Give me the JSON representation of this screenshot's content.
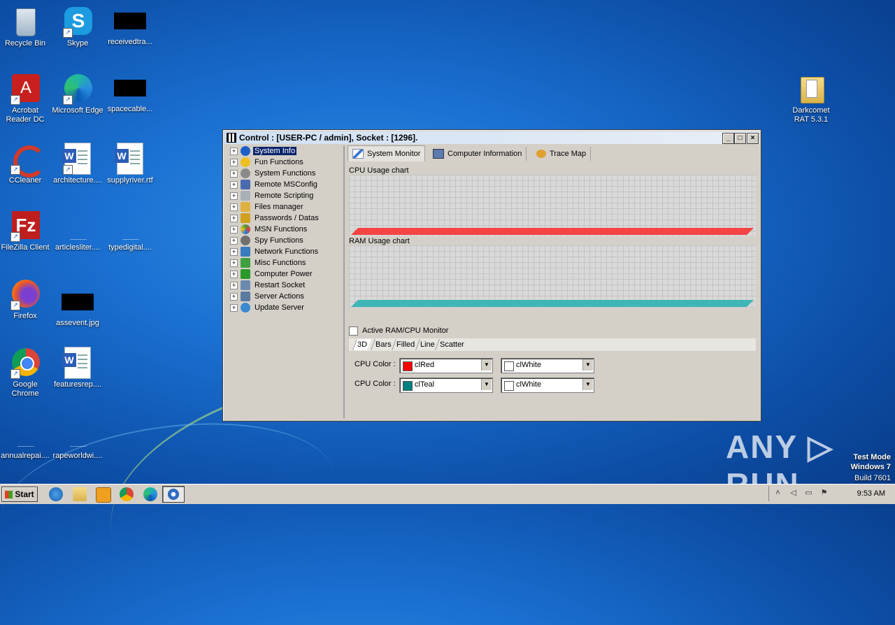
{
  "desktop": {
    "icons": [
      {
        "label": "Recycle Bin"
      },
      {
        "label": "Skype"
      },
      {
        "label": "receivedtra..."
      },
      {
        "label": "Acrobat Reader DC"
      },
      {
        "label": "Microsoft Edge"
      },
      {
        "label": "spacecable..."
      },
      {
        "label": "CCleaner"
      },
      {
        "label": "architecture...."
      },
      {
        "label": "supplyriver.rtf"
      },
      {
        "label": "FileZilla Client"
      },
      {
        "label": "articlesliter...."
      },
      {
        "label": "typedigital...."
      },
      {
        "label": "Firefox"
      },
      {
        "label": "assevent.jpg"
      },
      {
        "label": "Google Chrome"
      },
      {
        "label": "featuresrep...."
      },
      {
        "label": "annualrepai...."
      },
      {
        "label": "rapeworldwi...."
      },
      {
        "label": "Darkcomet RAT 5.3.1"
      }
    ]
  },
  "window": {
    "title": "Control : [USER-PC / admin], Socket : [1296].",
    "min_glyph": "_",
    "max_glyph": "□",
    "close_glyph": "×",
    "tree": [
      {
        "label": "System Info",
        "icon": "info-icon",
        "color": "#1f5fc8"
      },
      {
        "label": "Fun Functions",
        "icon": "smiley-icon",
        "color": "#f0c020"
      },
      {
        "label": "System Functions",
        "icon": "gear-icon",
        "color": "#8a8a8a"
      },
      {
        "label": "Remote MSConfig",
        "icon": "monitor-icon",
        "color": "#4a6ab0"
      },
      {
        "label": "Remote Scripting",
        "icon": "script-icon",
        "color": "#9aa"
      },
      {
        "label": "Files manager",
        "icon": "folder-icon",
        "color": "#e0b040"
      },
      {
        "label": "Passwords / Datas",
        "icon": "key-icon",
        "color": "#d0a020"
      },
      {
        "label": "MSN Functions",
        "icon": "msn-icon",
        "color": "#40a040"
      },
      {
        "label": "Spy Functions",
        "icon": "spy-icon",
        "color": "#707070"
      },
      {
        "label": "Network Functions",
        "icon": "network-icon",
        "color": "#3a7ac0"
      },
      {
        "label": "Misc Functions",
        "icon": "misc-icon",
        "color": "#40a040"
      },
      {
        "label": "Computer Power",
        "icon": "power-icon",
        "color": "#2a9a2a"
      },
      {
        "label": "Restart Socket",
        "icon": "socket-icon",
        "color": "#6a8ab0"
      },
      {
        "label": "Server Actions",
        "icon": "server-icon",
        "color": "#5a7aa0"
      },
      {
        "label": "Update Server",
        "icon": "update-icon",
        "color": "#3a8ad0"
      }
    ],
    "expand_glyph": "+",
    "tabs": [
      {
        "label": "System Monitor"
      },
      {
        "label": "Computer Information"
      },
      {
        "label": "Trace Map"
      }
    ],
    "cpu_chart_label": "CPU Usage chart",
    "ram_chart_label": "RAM Usage chart",
    "cpu_color": "#f44444",
    "ram_color": "#3fb6b6",
    "active_monitor_label": "Active RAM/CPU Monitor",
    "subtabs": [
      "3D",
      "Bars",
      "Filled",
      "Line",
      "Scatter"
    ],
    "options": [
      {
        "label": "CPU Color :",
        "color1_name": "clRed",
        "color1": "#ff0000",
        "color2_name": "clWhite",
        "color2": "#ffffff"
      },
      {
        "label": "CPU Color :",
        "color1_name": "clTeal",
        "color1": "#008080",
        "color2_name": "clWhite",
        "color2": "#ffffff"
      }
    ],
    "dropdown_glyph": "▼"
  },
  "taskbar": {
    "start_label": "Start",
    "clock": "9:53 AM"
  },
  "watermark": {
    "brand": "ANY ▷ RUN",
    "testmode_line1": "Test Mode",
    "testmode_line2": "Windows 7",
    "testmode_line3": "Build 7601"
  }
}
